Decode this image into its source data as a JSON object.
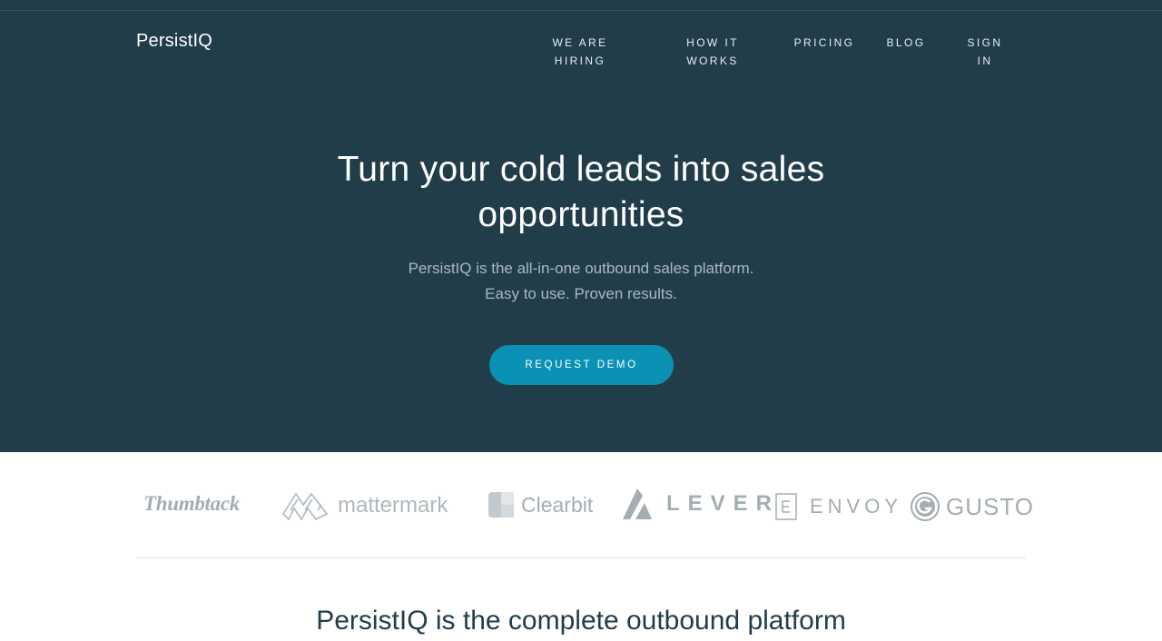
{
  "header": {
    "brand": "PersistIQ",
    "nav": [
      {
        "label": "WE ARE HIRING"
      },
      {
        "label": "HOW IT WORKS"
      },
      {
        "label": "PRICING"
      },
      {
        "label": "BLOG"
      },
      {
        "label": "SIGN IN"
      }
    ]
  },
  "hero": {
    "title": "Turn your cold leads into sales opportunities",
    "subtitle_line1": "PersistIQ is the all-in-one outbound sales platform.",
    "subtitle_line2": "Easy to use. Proven results.",
    "cta_label": "REQUEST DEMO"
  },
  "customers": [
    {
      "name": "Thumbtack"
    },
    {
      "name": "mattermark"
    },
    {
      "name": "Clearbit"
    },
    {
      "name": "LEVER"
    },
    {
      "name": "ENVOY"
    },
    {
      "name": "GUSTO"
    }
  ],
  "section": {
    "title": "PersistIQ is the complete outbound platform"
  },
  "colors": {
    "hero_bg": "#223d4a",
    "accent": "#0b91b3",
    "logo_gray": "#a4adb2"
  }
}
